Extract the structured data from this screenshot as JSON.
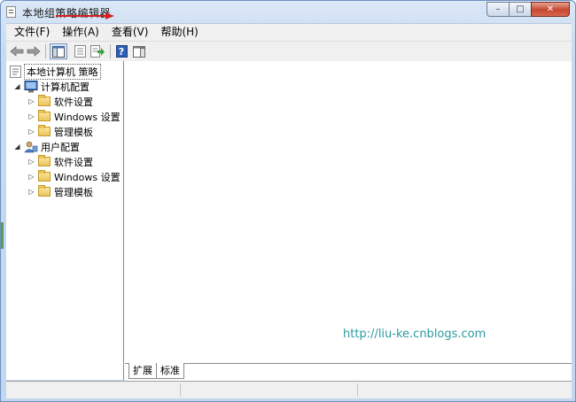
{
  "window": {
    "title": "本地组策略编辑器",
    "caption": {
      "minimize": "–",
      "maximize": "□",
      "close": "✕"
    }
  },
  "menu": [
    {
      "label": "文件(F)"
    },
    {
      "label": "操作(A)"
    },
    {
      "label": "查看(V)"
    },
    {
      "label": "帮助(H)"
    }
  ],
  "toolbar": {
    "icons": [
      "back-icon",
      "forward-icon",
      "show-hide-console-tree-icon",
      "properties-icon",
      "export-list-icon",
      "help-icon",
      "show-hide-action-pane-icon"
    ],
    "help_glyph": "?"
  },
  "tree": {
    "root": "本地计算机 策略",
    "computer": {
      "label": "计算机配置",
      "children": [
        {
          "label": "软件设置"
        },
        {
          "label": "Windows 设置"
        },
        {
          "label": "管理模板"
        }
      ]
    },
    "user": {
      "label": "用户配置",
      "children": [
        {
          "label": "软件设置"
        },
        {
          "label": "Windows 设置"
        },
        {
          "label": "管理模板"
        }
      ]
    }
  },
  "content": {
    "watermark": "http://liu-ke.cnblogs.com"
  },
  "tabs": [
    {
      "label": "扩展"
    },
    {
      "label": "标准"
    }
  ],
  "colors": {
    "annotation_arrow": "#d42020",
    "watermark_text": "#2a9aa0",
    "close_button": "#c7472f"
  }
}
